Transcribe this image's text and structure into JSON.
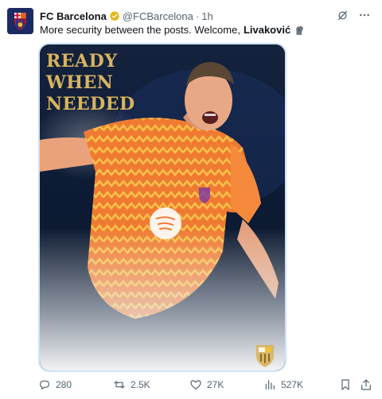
{
  "account": {
    "name": "FC Barcelona",
    "handle": "@FCBarcelona",
    "separator": "·",
    "time": "1h"
  },
  "tweet": {
    "text": "More security between the posts. Welcome,",
    "mention": "Livaković",
    "emoji": "gloves-emoji"
  },
  "media": {
    "poster_lines": [
      "READY",
      "WHEN",
      "NEEDED"
    ],
    "alt_subject": "goalkeeper in orange jersey celebrating"
  },
  "actions": {
    "replies": "280",
    "reposts": "2.5K",
    "likes": "27K",
    "views": "527K"
  },
  "colors": {
    "accent": "#1d9bf0",
    "verified": "#e2b719",
    "muted": "#536471",
    "jersey": "#f07a32",
    "title_gold": "#d9b45e"
  }
}
